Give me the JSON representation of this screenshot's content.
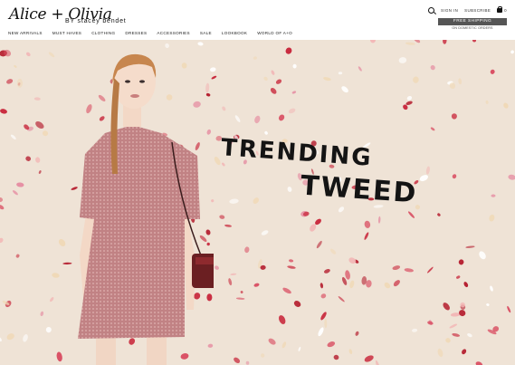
{
  "brand": {
    "logo_text": "Alice + Olivia",
    "logo_amp": "and",
    "sub_text": "BY stacey bendet"
  },
  "nav": {
    "items": [
      "NEW ARRIVALS",
      "MUST HAVES",
      "CLOTHING",
      "DRESSES",
      "ACCESSORIES",
      "SALE",
      "LOOKBOOK",
      "WORLD OF A+O"
    ]
  },
  "utility": {
    "sign_in": "SIGN IN",
    "subscribe": "SUBSCRIBE",
    "bag_count": "0"
  },
  "promo": {
    "badge": "FREE SHIPPING",
    "sub": "ON DOMESTIC ORDERS"
  },
  "hero": {
    "line1": "TRENDING",
    "line2": "TWEED"
  },
  "icons": [
    "search-icon",
    "bag-icon"
  ],
  "colors": {
    "hero_bg": "#efe3d6",
    "petal_red": "#c8283c",
    "dress": "#c98d8f"
  }
}
